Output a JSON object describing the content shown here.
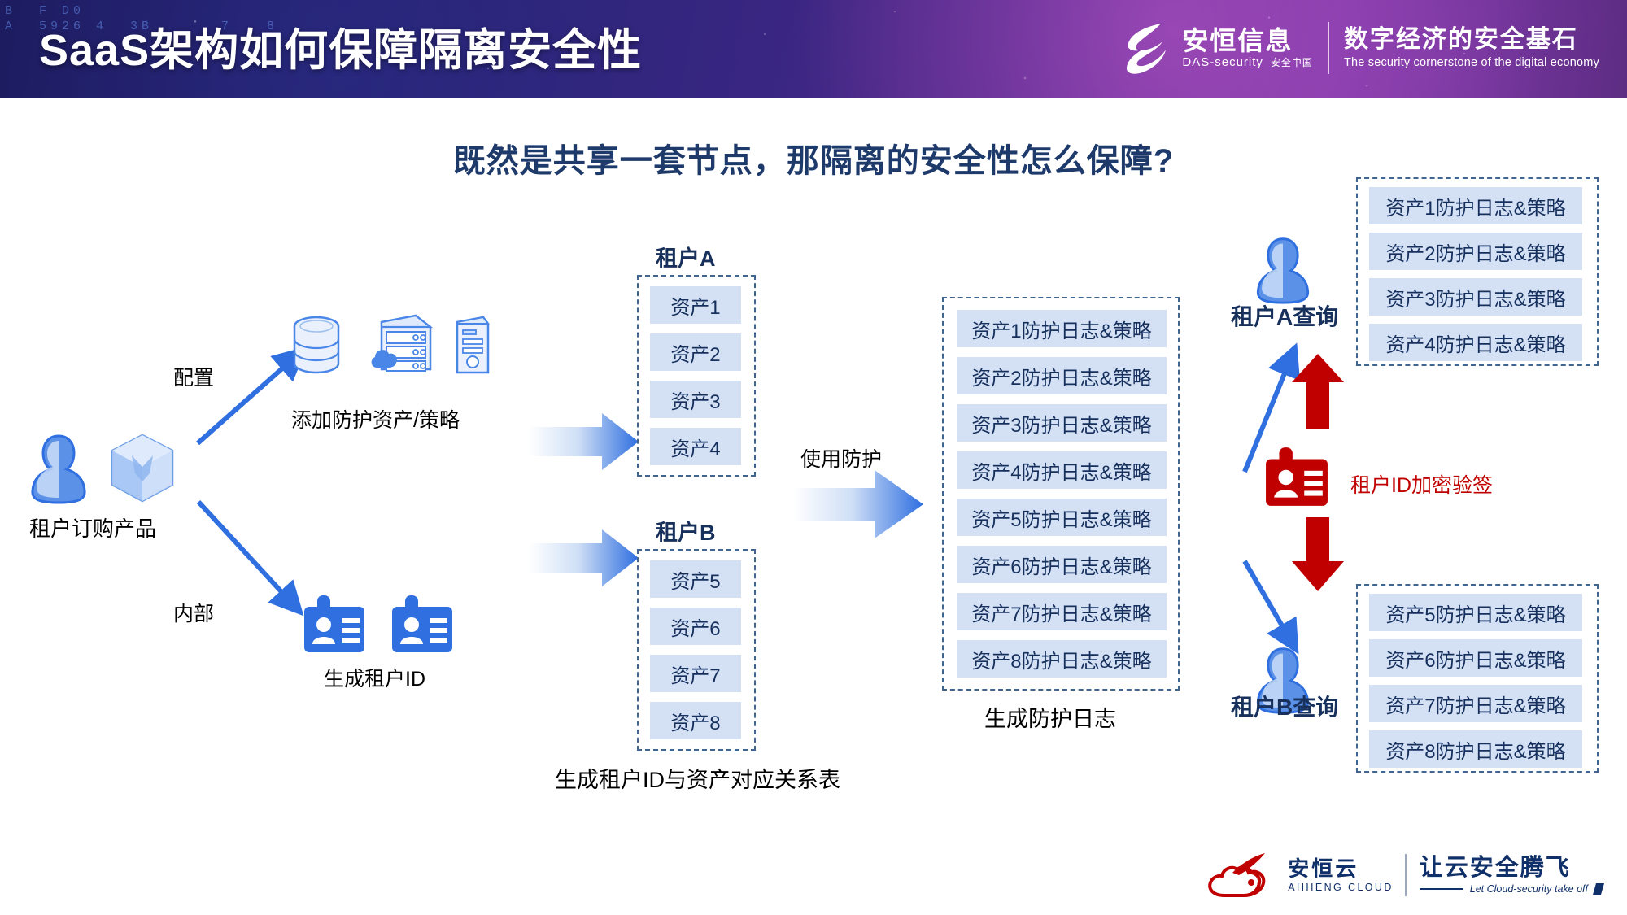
{
  "header": {
    "title": "SaaS架构如何保障隔离安全性",
    "code_bg": "B  F D0\nA  5926 4  3B      7   8",
    "logo": {
      "brand_cn": "安恒信息",
      "brand_en": "DAS-security",
      "brand_cn_small": "安全中国",
      "slogan_cn": "数字经济的安全基石",
      "slogan_en": "The security cornerstone of the digital economy"
    }
  },
  "subtitle": "既然是共享一套节点，那隔离的安全性怎么保障?",
  "flow": {
    "tenant_order_label": "租户订购产品",
    "edge_config": "配置",
    "edge_internal": "内部",
    "add_assets_label": "添加防护资产/策略",
    "gen_tenant_id_label": "生成租户ID",
    "use_protection_label": "使用防护",
    "mapping_caption": "生成租户ID与资产对应关系表",
    "gen_log_caption": "生成防护日志",
    "encrypt_sign_label": "租户ID加密验签"
  },
  "tenant_a": {
    "title": "租户A",
    "assets": [
      "资产1",
      "资产2",
      "资产3",
      "资产4"
    ]
  },
  "tenant_b": {
    "title": "租户B",
    "assets": [
      "资产5",
      "资产6",
      "资产7",
      "资产8"
    ]
  },
  "logs": {
    "items": [
      "资产1防护日志&策略",
      "资产2防护日志&策略",
      "资产3防护日志&策略",
      "资产4防护日志&策略",
      "资产5防护日志&策略",
      "资产6防护日志&策略",
      "资产7防护日志&策略",
      "资产8防护日志&策略"
    ]
  },
  "query_a": {
    "label": "租户A查询",
    "items": [
      "资产1防护日志&策略",
      "资产2防护日志&策略",
      "资产3防护日志&策略",
      "资产4防护日志&策略"
    ]
  },
  "query_b": {
    "label": "租户B查询",
    "items": [
      "资产5防护日志&策略",
      "资产6防护日志&策略",
      "资产7防护日志&策略",
      "资产8防护日志&策略"
    ]
  },
  "footer": {
    "brand_cn": "安恒云",
    "brand_en": "AHHENG CLOUD",
    "slogan_cn": "让云安全腾飞",
    "slogan_en": "Let Cloud-security take off"
  },
  "colors": {
    "header_purple": "#4a2580",
    "accent_blue": "#2f6fe0",
    "chip_bg": "#d4e0f3",
    "navy_text": "#17305c",
    "red": "#c00000"
  }
}
